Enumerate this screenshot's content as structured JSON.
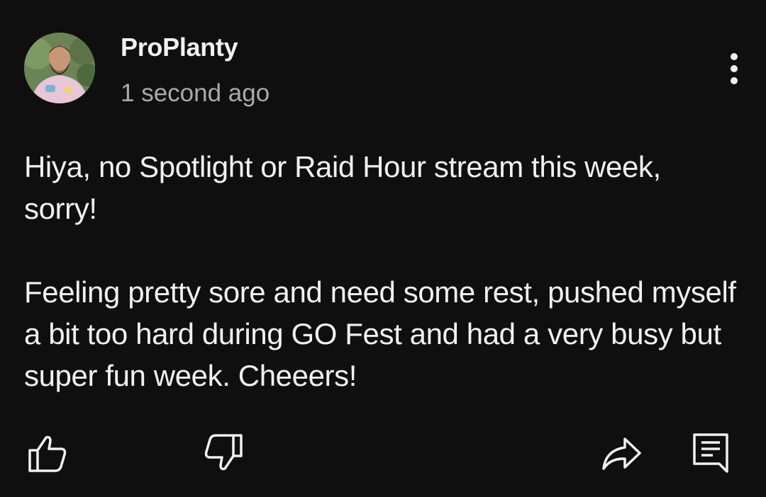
{
  "post": {
    "author": "ProPlanty",
    "timestamp": "1 second ago",
    "paragraphs": [
      "Hiya, no Spotlight or Raid Hour stream this week, sorry!",
      "Feeling pretty sore and need some rest, pushed myself a bit too hard during GO Fest and had a very busy but super fun week. Cheeers!"
    ]
  },
  "icons": {
    "avatar": "avatar-image",
    "more": "more-vert-icon",
    "like": "thumbs-up-icon",
    "dislike": "thumbs-down-icon",
    "share": "share-arrow-icon",
    "reply": "comment-reply-icon"
  },
  "colors": {
    "background": "#0f0f0f",
    "text": "#f1f1f1",
    "secondary_text": "#aaaaaa"
  }
}
